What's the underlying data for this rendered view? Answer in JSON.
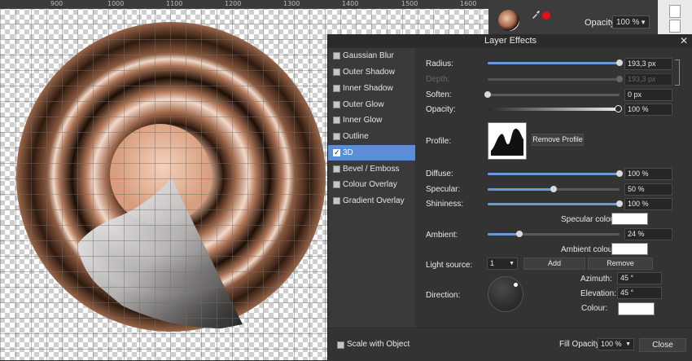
{
  "ruler": {
    "ticks": [
      "900",
      "1000",
      "1100",
      "1200",
      "1300",
      "1400",
      "1500",
      "1600"
    ]
  },
  "top_panel": {
    "opacity_label": "Opacity:",
    "opacity_value": "100 %",
    "color_icon": "eyedropper-icon",
    "accent_color": "#e81010"
  },
  "dialog": {
    "title": "Layer Effects",
    "close_glyph": "✕",
    "effects": [
      {
        "label": "Gaussian Blur",
        "checked": false
      },
      {
        "label": "Outer Shadow",
        "checked": false
      },
      {
        "label": "Inner Shadow",
        "checked": false
      },
      {
        "label": "Outer Glow",
        "checked": false
      },
      {
        "label": "Inner Glow",
        "checked": false
      },
      {
        "label": "Outline",
        "checked": false
      },
      {
        "label": "3D",
        "checked": true
      },
      {
        "label": "Bevel / Emboss",
        "checked": false
      },
      {
        "label": "Colour Overlay",
        "checked": false
      },
      {
        "label": "Gradient Overlay",
        "checked": false
      }
    ],
    "params": {
      "radius": {
        "label": "Radius:",
        "value": "193,3 px",
        "level": 1.0
      },
      "depth": {
        "label": "Depth:",
        "value": "193,3 px",
        "level": 1.0
      },
      "soften": {
        "label": "Soften:",
        "value": "0 px",
        "level": 0.0
      },
      "opacity": {
        "label": "Opacity:",
        "value": "100 %",
        "level": 1.0
      },
      "profile": {
        "label": "Profile:",
        "remove": "Remove Profile"
      },
      "diffuse": {
        "label": "Diffuse:",
        "value": "100 %",
        "level": 1.0
      },
      "specular": {
        "label": "Specular:",
        "value": "50 %",
        "level": 0.5
      },
      "shininess": {
        "label": "Shininess:",
        "value": "100 %",
        "level": 1.0
      },
      "specular_colour": {
        "label": "Specular colour:"
      },
      "ambient": {
        "label": "Ambient:",
        "value": "24 %",
        "level": 0.24
      },
      "ambient_colour": {
        "label": "Ambient colour:"
      },
      "light_source": {
        "label": "Light source:",
        "value": "1",
        "add": "Add",
        "remove": "Remove"
      },
      "direction": {
        "label": "Direction:"
      },
      "azimuth": {
        "label": "Azimuth:",
        "value": "45 °"
      },
      "elevation": {
        "label": "Elevation:",
        "value": "45 °"
      },
      "colour": {
        "label": "Colour:"
      }
    },
    "footer": {
      "scale_with_object": "Scale with Object",
      "fill_opacity_label": "Fill Opacity:",
      "fill_opacity_value": "100 %",
      "close": "Close"
    }
  }
}
